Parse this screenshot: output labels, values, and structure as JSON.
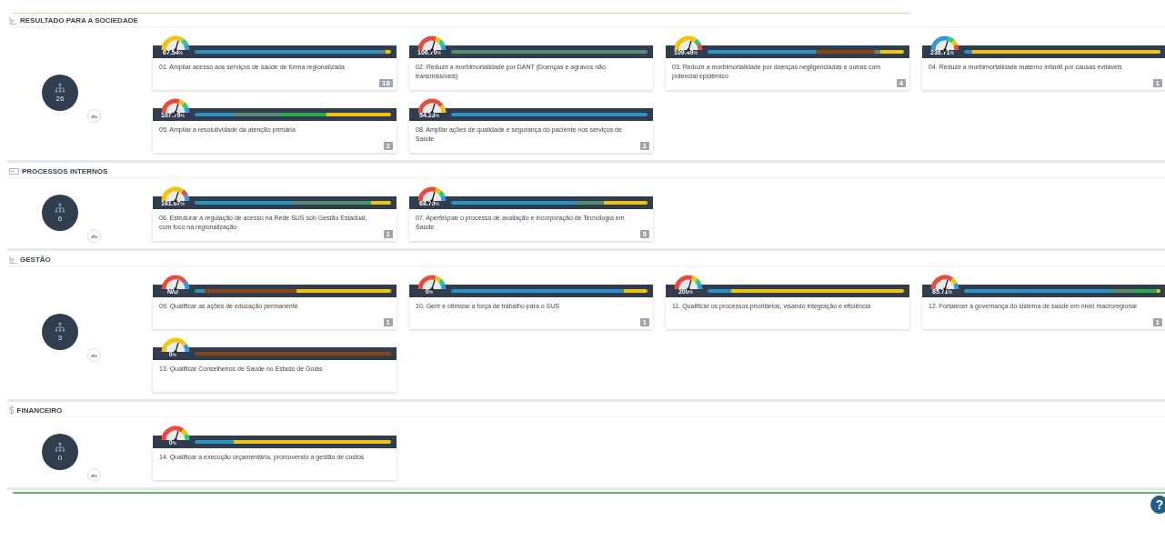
{
  "sections": [
    {
      "title": "RESULTADO PARA A SOCIEDADE",
      "kind": "tree",
      "count": "26",
      "cards": [
        {
          "value": "67.54",
          "unit": "%",
          "label": "01. Ampliar acesso aos serviços de saúde de forma regionalizada",
          "badge": "18",
          "gauge": [
            {
              "color": "#f1c40f"
            },
            {
              "color": "#2ecc71"
            },
            {
              "color": "#3498db"
            }
          ],
          "segments": [
            {
              "color": "#2a93c4",
              "level": 0.94
            },
            {
              "color": "#5b8a72",
              "kind": "wide"
            },
            {
              "color": "#f1c40f",
              "level": 0.03
            }
          ]
        },
        {
          "value": "106.70",
          "unit": "%",
          "label": "02. Reduzir a morbimortalidade por DANT (Doenças e agravos não transmissíveis)",
          "gauge": [
            {
              "color": "#e74c3c"
            },
            {
              "color": "#f1c40f"
            },
            {
              "color": "#2ecc71"
            },
            {
              "color": "#3498db"
            }
          ],
          "segments": [
            {
              "color": "#5b8a72",
              "level": 1
            }
          ]
        },
        {
          "value": "109.49",
          "unit": "%",
          "label": "03. Reduzir a morbimortalidade por doenças negligenciadas e outras com potencial epidêmico",
          "badge": "4",
          "gauge": [
            {
              "color": "#f1c40f"
            },
            {
              "color": "#2ecc71"
            },
            {
              "color": "#e74c3c"
            }
          ],
          "segments": [
            {
              "color": "#2a93c4",
              "level": 0.55
            },
            {
              "color": "#8b4513",
              "kind": "wide"
            },
            {
              "color": "#5b8a72",
              "kind": "narrow"
            },
            {
              "color": "#f1c40f",
              "level": 0.12
            }
          ]
        },
        {
          "value": "236.71",
          "unit": "%",
          "label": "04. Reduzir a morbimortalidade materno infantil por causas evitáveis",
          "badge": "1",
          "gauge": [
            {
              "color": "#3498db"
            },
            {
              "color": "#2ecc71"
            },
            {
              "color": "#f1c40f"
            },
            {
              "color": "#e74c3c"
            }
          ],
          "segments": [
            {
              "color": "#2a93c4",
              "level": 0.04
            },
            {
              "color": "#f1c40f",
              "level": 0.96
            }
          ]
        },
        {
          "value": "107.79",
          "unit": "%",
          "label": "05. Ampliar a resolutividade da atenção primária",
          "badge": "2",
          "gauge": [
            {
              "color": "#e74c3c"
            },
            {
              "color": "#f1c40f"
            },
            {
              "color": "#2ecc71"
            },
            {
              "color": "#3498db"
            }
          ],
          "segments": [
            {
              "color": "#2a93c4",
              "level": 0.2
            },
            {
              "color": "#5b8a72",
              "kind": "wide"
            },
            {
              "color": "#2bab4a",
              "kind": "wide"
            },
            {
              "color": "#f1c40f",
              "level": 0.33
            }
          ]
        },
        {
          "value": "54.23",
          "unit": "%",
          "label": "08. Ampliar ações de qualidade e segurança do paciente nos serviços de Saúde",
          "badge": "1",
          "gauge": [
            {
              "color": "#e74c3c"
            },
            {
              "color": "#f1c40f"
            }
          ],
          "segments": [
            {
              "color": "#2a93c4",
              "level": 1
            }
          ]
        }
      ]
    },
    {
      "title": "PROCESSOS INTERNOS",
      "kind": "card",
      "count": "6",
      "cards": [
        {
          "value": "161.67",
          "unit": "%",
          "label": "06. Estruturar a regulação de acesso na Rede SUS sob Gestão Estadual, com foco na regionalização",
          "badge": "1",
          "gauge": [
            {
              "color": "#f1c40f"
            },
            {
              "color": "#e74c3c"
            },
            {
              "color": "#3498db"
            }
          ],
          "segments": [
            {
              "color": "#2a93c4",
              "level": 0.5
            },
            {
              "color": "#5b8a72",
              "kind": "wide"
            },
            {
              "color": "#2bab4a",
              "kind": "narrow"
            },
            {
              "color": "#f1c40f",
              "level": 0.1
            }
          ]
        },
        {
          "value": "68.75",
          "unit": "%",
          "label": "07. Aperfeiçoar o processo de avaliação e incorporação de Tecnologia em Saúde",
          "badge": "5",
          "gauge": [
            {
              "color": "#e74c3c"
            },
            {
              "color": "#f1c40f"
            },
            {
              "color": "#2ecc71"
            },
            {
              "color": "#3498db"
            }
          ],
          "segments": [
            {
              "color": "#2a93c4",
              "level": 0.64
            },
            {
              "color": "#5b8a72",
              "kind": "wide"
            },
            {
              "color": "#f1c40f",
              "level": 0.22
            }
          ]
        }
      ]
    },
    {
      "title": "GESTÃO",
      "kind": "tree",
      "count": "3",
      "cards": [
        {
          "value": "N/D",
          "label": "09. Qualificar as ações de educação permanente",
          "badge": "1",
          "gauge": [
            {
              "color": "#e74c3c"
            },
            {
              "color": "#3498db"
            }
          ],
          "segments": [
            {
              "color": "#2a93c4",
              "level": 0.05
            },
            {
              "color": "#8b4513",
              "kind": "wide"
            },
            {
              "color": "#f1c40f",
              "level": 0.48
            }
          ]
        },
        {
          "value": "0",
          "unit": "%",
          "label": "10. Gerir e otimizar a força de trabalho para o SUS",
          "badge": "1",
          "gauge": [
            {
              "color": "#e74c3c"
            },
            {
              "color": "#f1c40f"
            },
            {
              "color": "#2ecc71"
            },
            {
              "color": "#3498db"
            }
          ],
          "segments": [
            {
              "color": "#2a93c4",
              "level": 0.87
            },
            {
              "color": "#5b8a72",
              "kind": "wide"
            },
            {
              "color": "#f1c40f",
              "level": 0.12
            }
          ]
        },
        {
          "value": "200",
          "unit": "%",
          "label": "11. Qualificar os processos prioritários, visando integração e eficiência",
          "gauge": [
            {
              "color": "#e74c3c"
            },
            {
              "color": "#f1c40f"
            },
            {
              "color": "#2ecc71"
            },
            {
              "color": "#3498db"
            }
          ],
          "segments": [
            {
              "color": "#2a93c4",
              "level": 0.12
            },
            {
              "color": "#f1c40f",
              "level": 0.88
            }
          ]
        },
        {
          "value": "85.71",
          "unit": "%",
          "label": "12. Fortalecer a governança do sistema de saúde em nível macroregional",
          "badge": "1",
          "gauge": [
            {
              "color": "#e74c3c"
            },
            {
              "color": "#f1c40f"
            },
            {
              "color": "#3498db"
            }
          ],
          "segments": [
            {
              "color": "#2a93c4",
              "level": 0.75
            },
            {
              "color": "#5b8a72",
              "kind": "wide"
            },
            {
              "color": "#2bab4a",
              "kind": "wide"
            },
            {
              "color": "#f1c40f",
              "level": 0.02
            }
          ]
        },
        {
          "value": "0",
          "unit": "%",
          "label": "13. Qualificar Conselheiros de Saúde no Estado de Goiás",
          "gauge": [
            {
              "color": "#f1c40f"
            },
            {
              "color": "#3498db"
            }
          ],
          "segments": [
            {
              "color": "#8b4513",
              "level": 1
            }
          ]
        }
      ]
    },
    {
      "title": "FINANCEIRO",
      "kind": "text",
      "icon_text": "$",
      "count": "0",
      "cards": [
        {
          "value": "0",
          "unit": "%",
          "label": "14. Qualificar a execução orçamentária, promovendo a gestão de custos",
          "gauge": [
            {
              "color": "#e74c3c"
            },
            {
              "color": "#f1c40f"
            },
            {
              "color": "#2ecc71"
            }
          ],
          "segments": [
            {
              "color": "#2a93c4",
              "level": 0.2
            },
            {
              "color": "#f1c40f",
              "level": 0.8
            }
          ]
        }
      ]
    }
  ],
  "help_button": "?"
}
